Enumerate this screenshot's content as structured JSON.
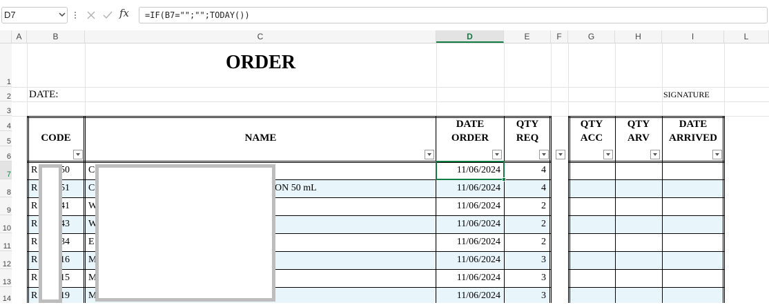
{
  "formula_bar": {
    "name_box": "D7",
    "formula": "=IF(B7=\"\";\"\";TODAY())"
  },
  "columns": [
    "A",
    "B",
    "C",
    "D",
    "E",
    "F",
    "G",
    "H",
    "I",
    "L"
  ],
  "selected_column": "D",
  "rows": [
    "1",
    "2",
    "3",
    "4",
    "5",
    "6",
    "7",
    "8",
    "9",
    "10",
    "11",
    "12",
    "13",
    "14"
  ],
  "selected_row": "7",
  "sheet": {
    "title": "ORDER",
    "date_label": "DATE:",
    "signature_label": "SIGNATURE",
    "headers": {
      "code": "CODE",
      "name": "NAME",
      "date_order_1": "DATE",
      "date_order_2": "ORDER",
      "qty_req_1": "QTY",
      "qty_req_2": "REQ",
      "qty_acc_1": "QTY",
      "qty_acc_2": "ACC",
      "qty_arv_1": "QTY",
      "qty_arv_2": "ARV",
      "date_arr_1": "DATE",
      "date_arr_2": "ARRIVED"
    },
    "data_rows": [
      {
        "code_a": "R",
        "code_b": "50",
        "name_a": "C",
        "name_b": "",
        "date": "11/06/2024",
        "qty": "4"
      },
      {
        "code_a": "R",
        "code_b": "51",
        "name_a": "C",
        "name_b": "ON 50 mL",
        "date": "11/06/2024",
        "qty": "4"
      },
      {
        "code_a": "R",
        "code_b": "41",
        "name_a": "W",
        "name_b": "",
        "date": "11/06/2024",
        "qty": "2"
      },
      {
        "code_a": "R",
        "code_b": "43",
        "name_a": "W",
        "name_b": "",
        "date": "11/06/2024",
        "qty": "2"
      },
      {
        "code_a": "R",
        "code_b": "34",
        "name_a": "E",
        "name_b": "",
        "date": "11/06/2024",
        "qty": "2"
      },
      {
        "code_a": "R",
        "code_b": "16",
        "name_a": "M",
        "name_b": "",
        "date": "11/06/2024",
        "qty": "3"
      },
      {
        "code_a": "R",
        "code_b": "15",
        "name_a": "M",
        "name_b": "",
        "date": "11/06/2024",
        "qty": "3"
      },
      {
        "code_a": "R",
        "code_b": "19",
        "name_a": "M",
        "name_b": "",
        "date": "11/06/2024",
        "qty": "3"
      }
    ]
  },
  "colors": {
    "accent_green": "#107c41",
    "band_blue": "#e8f5fb"
  }
}
